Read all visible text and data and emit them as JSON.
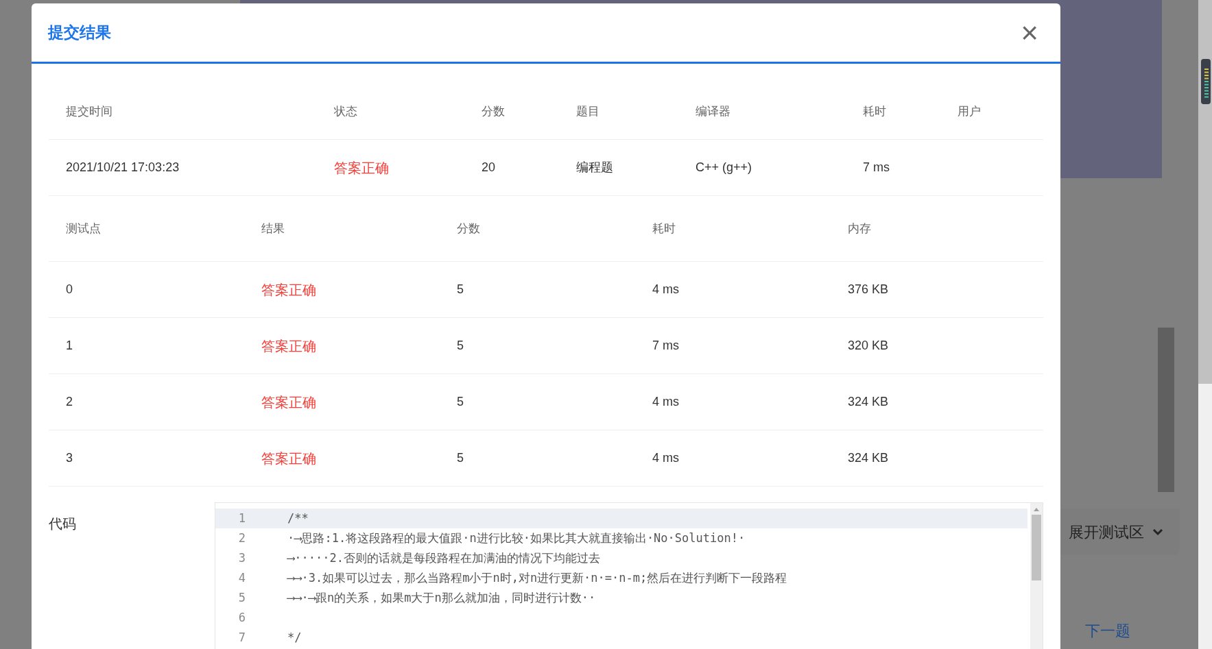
{
  "background": {
    "expand_button": "展开测试区",
    "next_link": "下一题"
  },
  "dialog": {
    "title": "提交结果",
    "close": "×"
  },
  "submission": {
    "columns": [
      "提交时间",
      "状态",
      "分数",
      "题目",
      "编译器",
      "耗时",
      "用户"
    ],
    "rows": [
      {
        "cells": [
          "2021/10/21 17:03:23",
          "答案正确",
          "20",
          "编程题",
          "C++ (g++)",
          "7 ms"
        ]
      }
    ]
  },
  "tests": {
    "columns": [
      "测试点",
      "结果",
      "分数",
      "耗时",
      "内存"
    ],
    "rows": [
      {
        "cells": [
          "0",
          "答案正确",
          "5",
          "4 ms",
          "376 KB"
        ]
      },
      {
        "cells": [
          "1",
          "答案正确",
          "5",
          "7 ms",
          "320 KB"
        ]
      },
      {
        "cells": [
          "2",
          "答案正确",
          "5",
          "4 ms",
          "324 KB"
        ]
      },
      {
        "cells": [
          "3",
          "答案正确",
          "5",
          "4 ms",
          "324 KB"
        ]
      }
    ]
  },
  "code": {
    "label": "代码",
    "lines": [
      {
        "number": "1",
        "text": "/**",
        "highlighted": true
      },
      {
        "number": "2",
        "text": "·⟶思路:1.将这段路程的最大值跟·n进行比较·如果比其大就直接输出·No·Solution!·",
        "highlighted": false
      },
      {
        "number": "3",
        "text": "⟶·····2.否则的话就是每段路程在加满油的情况下均能过去",
        "highlighted": false
      },
      {
        "number": "4",
        "text": "⟶⟶·3.如果可以过去，那么当路程m小于n时,对n进行更新·n·=·n-m;然后在进行判断下一段路程",
        "highlighted": false
      },
      {
        "number": "5",
        "text": "⟶⟶·⟶跟n的关系，如果m大于n那么就加油，同时进行计数··",
        "highlighted": false
      },
      {
        "number": "6",
        "highlighted": false
      },
      {
        "number": "7",
        "text": "*/",
        "highlighted": false
      }
    ]
  }
}
